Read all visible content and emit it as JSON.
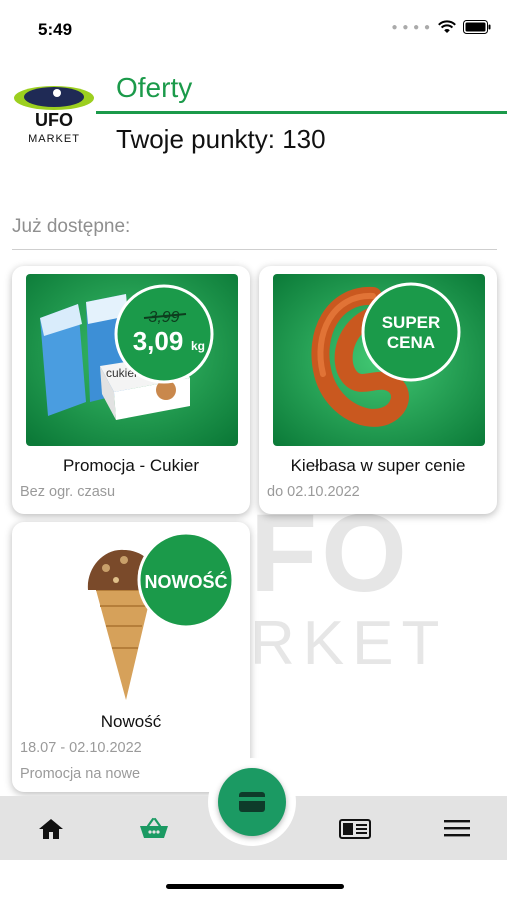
{
  "status_bar": {
    "time": "5:49"
  },
  "header": {
    "title": "Oferty",
    "points_text": "Twoje punkty: 130",
    "logo": {
      "brand_top": "UFO",
      "brand_bottom": "MARKET"
    }
  },
  "watermark": {
    "line1": "FO",
    "line2": "RKET"
  },
  "section": {
    "label": "Już dostępne:"
  },
  "offers": [
    {
      "title": "Promocja - Cukier",
      "lines": [
        "Bez ogr. czasu"
      ],
      "badge": {
        "old_price": "3,99",
        "new_price": "3,09",
        "unit": "kg"
      },
      "image_label": "cukier"
    },
    {
      "title": "Kiełbasa w super cenie",
      "lines": [
        "do 02.10.2022"
      ],
      "badge": {
        "line1": "SUPER",
        "line2": "CENA"
      }
    },
    {
      "title": "Nowość",
      "lines": [
        "18.07 - 02.10.2022",
        "Promocja na nowe"
      ],
      "badge": {
        "text": "NOWOŚĆ"
      }
    }
  ],
  "colors": {
    "brand_green": "#1b9a4a",
    "accent": "#1b9a63",
    "nav_bg": "#e3e3e3"
  },
  "nav": {
    "items": [
      {
        "icon": "home-icon"
      },
      {
        "icon": "basket-icon"
      },
      {
        "icon": "card-icon"
      },
      {
        "icon": "newspaper-icon"
      },
      {
        "icon": "menu-icon"
      }
    ]
  }
}
